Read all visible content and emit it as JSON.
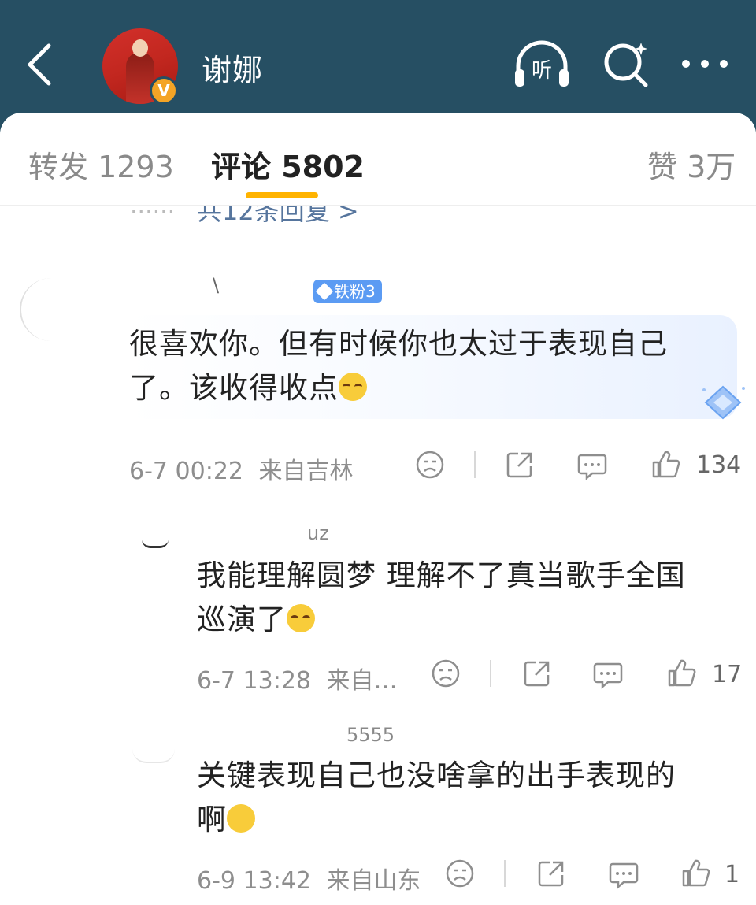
{
  "header": {
    "title": "谢娜",
    "verified_badge": "V",
    "listen_label": "听",
    "icons": [
      "back-icon",
      "listen-icon",
      "search-icon",
      "more-icon"
    ],
    "background": "#264f63"
  },
  "tabs": {
    "repost": "转发 1293",
    "comments": "评论 5802",
    "likes": "赞 3万",
    "accent": "#ffb300"
  },
  "previous": {
    "reply_link": "共12条回复 >",
    "dots": "......"
  },
  "comments": [
    {
      "name": "\\",
      "fan_badge": "铁粉3",
      "text_line1": "很喜欢你。但有时候你也太过于表现自己",
      "text_line2": "了。该收得收点",
      "time": "6-7 00:22",
      "location": "来自吉林",
      "likes": "134"
    },
    {
      "name": "uz",
      "text_line1": "我能理解圆梦 理解不了真当歌手全国",
      "text_line2": "巡演了",
      "time": "6-7 13:28",
      "location": "来自…",
      "likes": "17"
    },
    {
      "name": "5555",
      "text_line1": "关键表现自己也没啥拿的出手表现的",
      "text_line2": "啊",
      "time": "6-9 13:42",
      "location": "来自山东",
      "likes": "1"
    }
  ]
}
